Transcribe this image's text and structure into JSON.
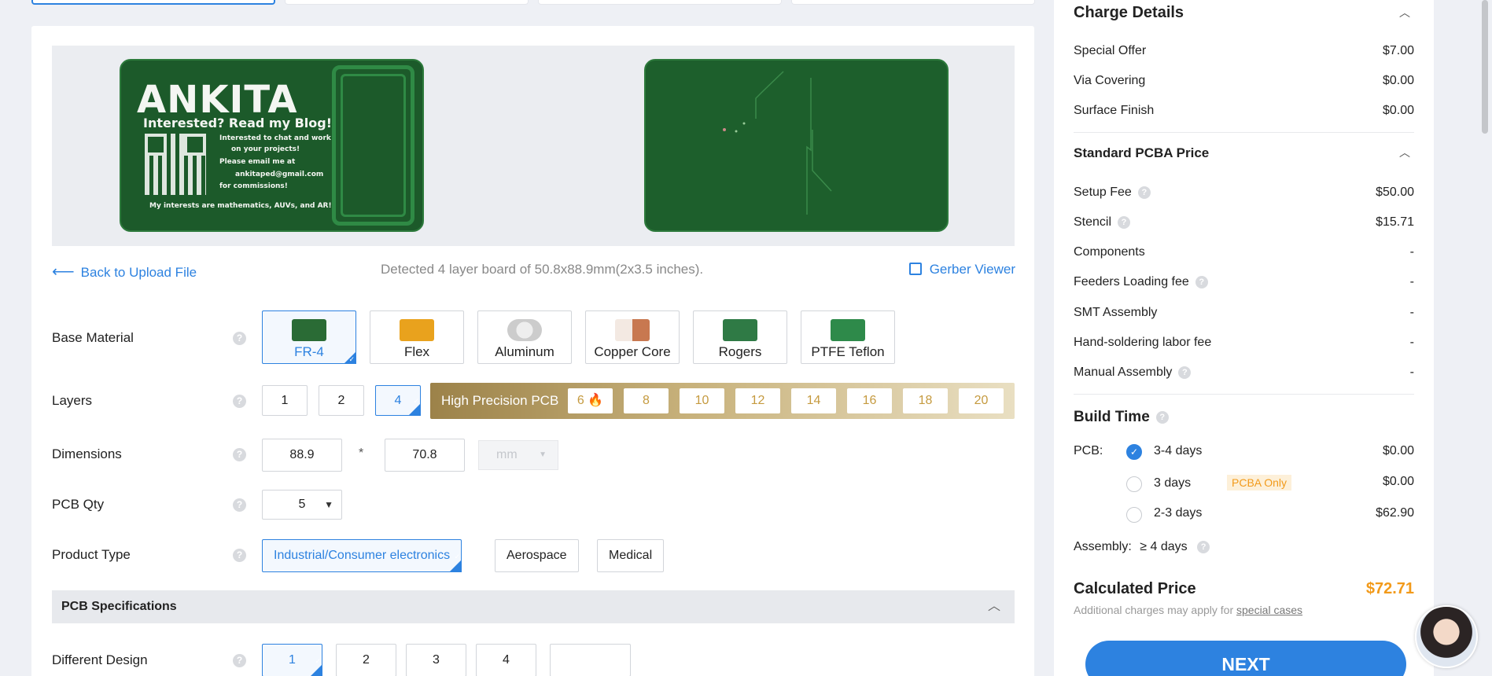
{
  "board_preview": {
    "front_title": "ANKITA",
    "front_subtitle": "Interested? Read my Blog!",
    "front_lines": [
      "Interested to chat and work",
      "on your projects!",
      "Please email me at",
      "ankitaped@gmail.com",
      "for commissions!"
    ],
    "front_footer": "My interests are mathematics, AUVs, and AR!"
  },
  "info_row": {
    "back_link": "Back to Upload File",
    "detected": "Detected 4 layer board of 50.8x88.9mm(2x3.5 inches).",
    "gerber_viewer": "Gerber Viewer"
  },
  "base_material": {
    "label": "Base Material",
    "options": [
      "FR-4",
      "Flex",
      "Aluminum",
      "Copper Core",
      "Rogers",
      "PTFE Teflon"
    ],
    "selected": "FR-4"
  },
  "layers": {
    "label": "Layers",
    "options": [
      "1",
      "2",
      "4"
    ],
    "selected": "4",
    "high_precision_label": "High Precision PCB",
    "high_precision_options": [
      "6",
      "8",
      "10",
      "12",
      "14",
      "16",
      "18",
      "20"
    ]
  },
  "dimensions": {
    "label": "Dimensions",
    "width": "88.9",
    "separator": "*",
    "height": "70.8",
    "unit": "mm"
  },
  "pcb_qty": {
    "label": "PCB Qty",
    "value": "5"
  },
  "product_type": {
    "label": "Product Type",
    "options": [
      "Industrial/Consumer electronics",
      "Aerospace",
      "Medical"
    ],
    "selected": "Industrial/Consumer electronics"
  },
  "pcb_spec": {
    "title": "PCB Specifications"
  },
  "different_design": {
    "label": "Different Design",
    "options": [
      "1",
      "2",
      "3",
      "4",
      ""
    ],
    "selected": "1"
  },
  "help_glyph": "?",
  "charge_details": {
    "title": "Charge Details",
    "rows": [
      {
        "label": "Special Offer",
        "value": "$7.00"
      },
      {
        "label": "Via Covering",
        "value": "$0.00"
      },
      {
        "label": "Surface Finish",
        "value": "$0.00"
      }
    ]
  },
  "pcba_price": {
    "title": "Standard PCBA Price",
    "rows": [
      {
        "label": "Setup Fee",
        "value": "$50.00"
      },
      {
        "label": "Stencil",
        "value": "$15.71"
      },
      {
        "label": "Components",
        "value": "-"
      },
      {
        "label": "Feeders Loading fee",
        "value": "-"
      },
      {
        "label": "SMT Assembly",
        "value": "-"
      },
      {
        "label": "Hand-soldering labor fee",
        "value": "-"
      },
      {
        "label": "Manual Assembly",
        "value": "-"
      }
    ]
  },
  "build_time": {
    "title": "Build Time",
    "pcb_label": "PCB:",
    "options": [
      {
        "label": "3-4 days",
        "value": "$0.00",
        "checked": true
      },
      {
        "label": "3 days",
        "value": "$0.00",
        "badge": "PCBA Only"
      },
      {
        "label": "2-3 days",
        "value": "$62.90"
      }
    ],
    "assembly_label": "Assembly:",
    "assembly_value": "≥ 4 days"
  },
  "calculated": {
    "title": "Calculated Price",
    "value": "$72.71",
    "note_prefix": "Additional charges may apply for",
    "note_link": "special cases"
  },
  "next_button": "NEXT",
  "colors": {
    "accent": "#2d82e0",
    "price": "#f29a1a",
    "board_green": "#1c5a2a",
    "gold": "#c59a3f"
  }
}
